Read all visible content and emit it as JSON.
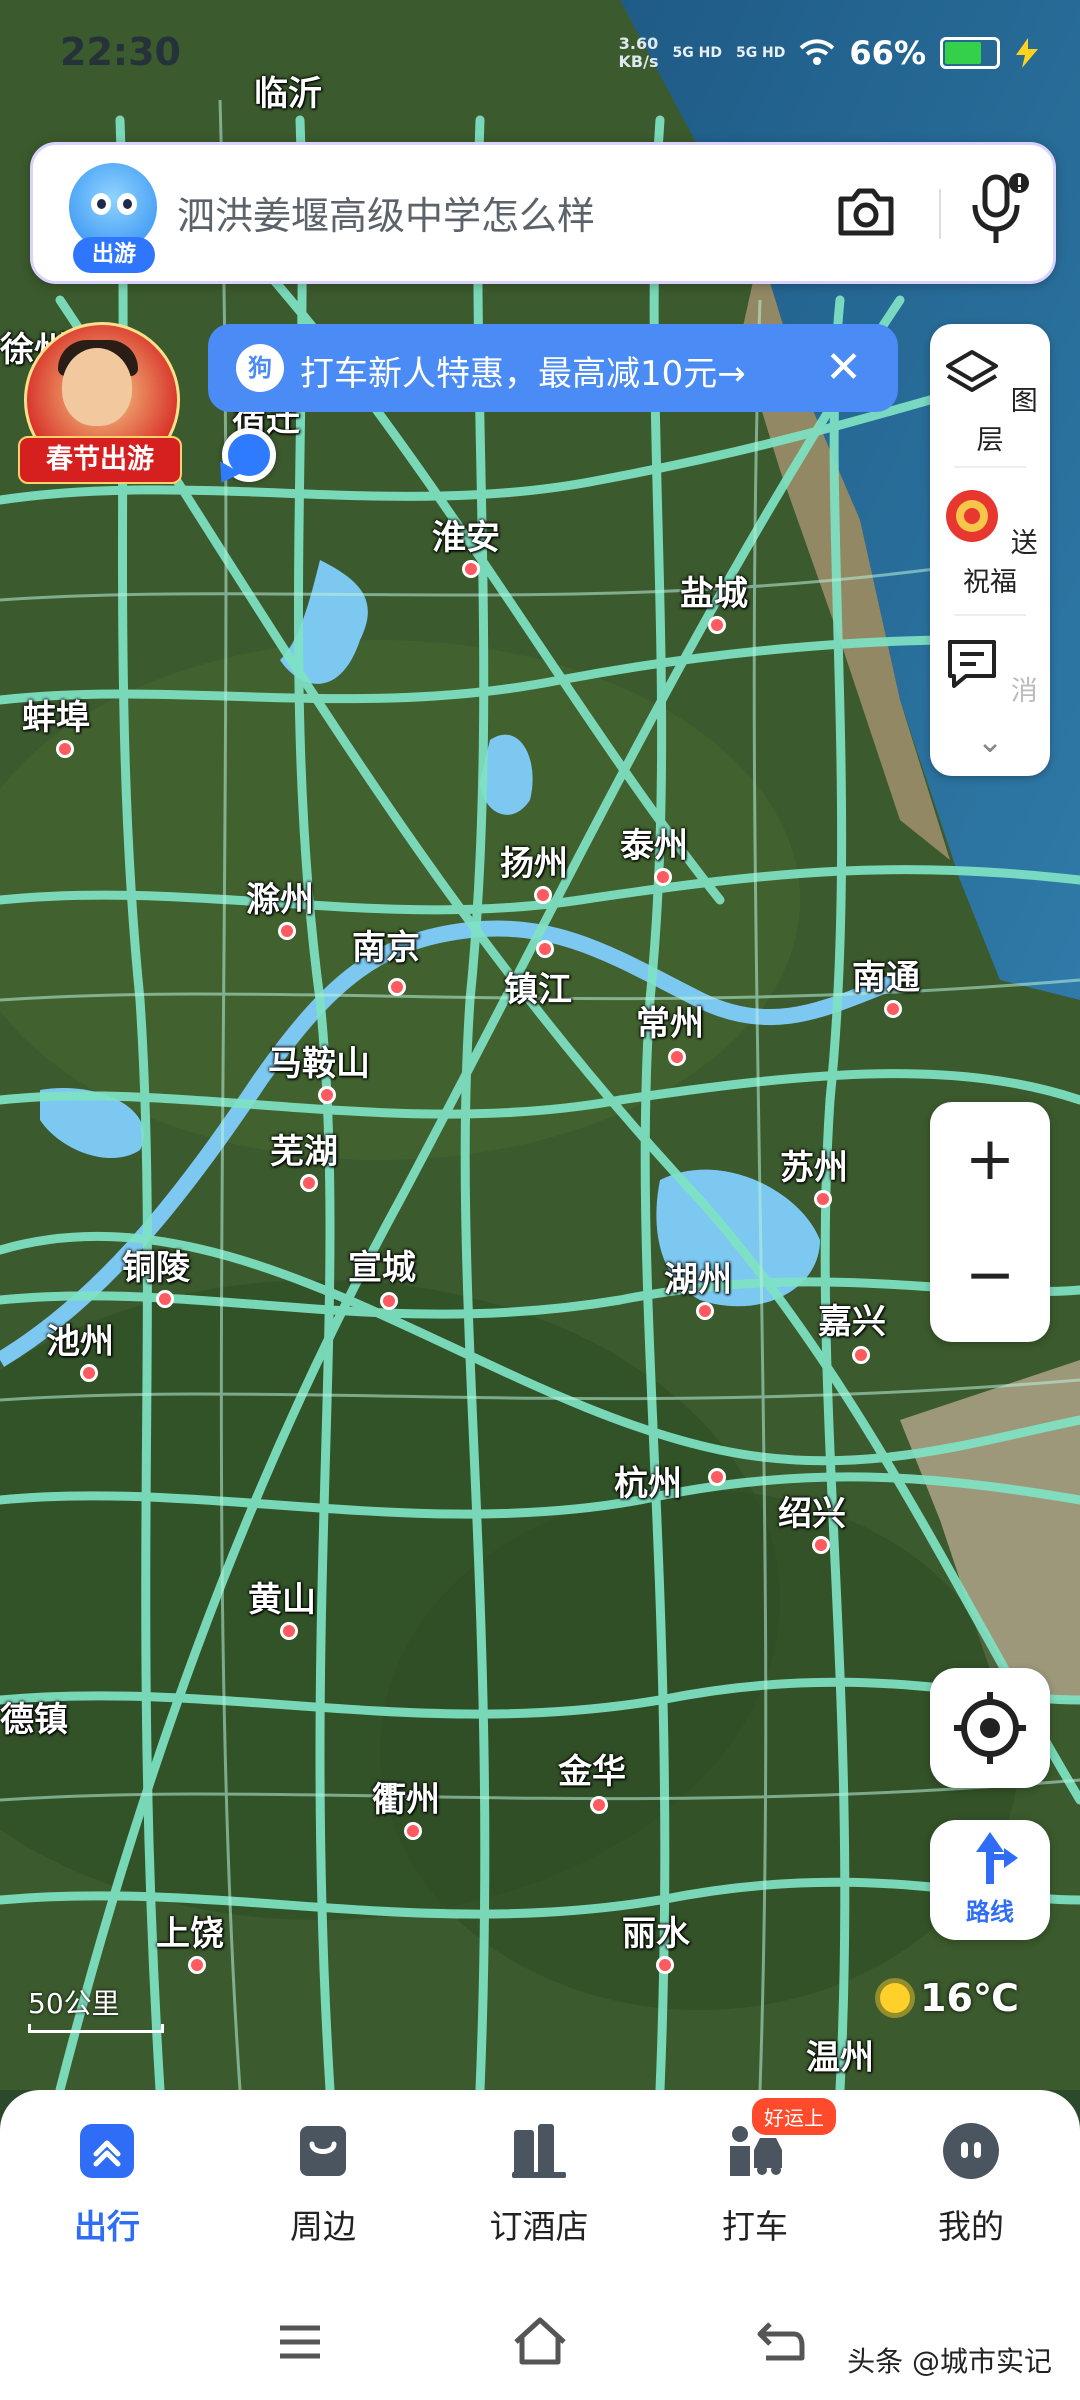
{
  "status_bar": {
    "time": "22:30",
    "net_speed_value": "3.60",
    "net_speed_unit": "KB/s",
    "sim1": "5G HD",
    "sim2": "5G HD",
    "battery": "66%"
  },
  "search": {
    "avatar_chip": "出游",
    "query": "泗洪姜堰高级中学怎么样",
    "icons": [
      "camera-icon",
      "microphone-icon"
    ]
  },
  "festival_badge": {
    "label": "春节出游"
  },
  "promo_banner": {
    "text": "打车新人特惠，最高减10元→",
    "close": "✕",
    "logo": "狗"
  },
  "right_panel": {
    "layers_label": "图层",
    "blessing_label": "送祝福",
    "message_label": "消息",
    "expand": "⌄"
  },
  "zoom": {
    "in": "+",
    "out": "−"
  },
  "route_button": {
    "label": "路线"
  },
  "scale_bar": {
    "label": "50公里"
  },
  "weather": {
    "temperature": "16℃",
    "icon": "sun-icon"
  },
  "cities": [
    {
      "name": "临沂"
    },
    {
      "name": "宿迁"
    },
    {
      "name": "淮安"
    },
    {
      "name": "盐城"
    },
    {
      "name": "蚌埠"
    },
    {
      "name": "扬州"
    },
    {
      "name": "泰州"
    },
    {
      "name": "滁州"
    },
    {
      "name": "南京"
    },
    {
      "name": "镇江"
    },
    {
      "name": "南通"
    },
    {
      "name": "常州"
    },
    {
      "name": "马鞍山"
    },
    {
      "name": "芜湖"
    },
    {
      "name": "苏州"
    },
    {
      "name": "铜陵"
    },
    {
      "name": "宣城"
    },
    {
      "name": "湖州"
    },
    {
      "name": "嘉兴"
    },
    {
      "name": "池州"
    },
    {
      "name": "杭州"
    },
    {
      "name": "绍兴"
    },
    {
      "name": "黄山"
    },
    {
      "name": "德镇"
    },
    {
      "name": "金华"
    },
    {
      "name": "衢州"
    },
    {
      "name": "上饶"
    },
    {
      "name": "丽水"
    },
    {
      "name": "温州"
    },
    {
      "name": "徐州"
    }
  ],
  "tab_bar": {
    "tabs": [
      {
        "label": "出行",
        "active": true
      },
      {
        "label": "周边",
        "active": false
      },
      {
        "label": "订酒店",
        "active": false
      },
      {
        "label": "打车",
        "active": false
      },
      {
        "label": "我的",
        "active": false
      }
    ],
    "taxi_badge": "好运上"
  },
  "nav_bar": {
    "icons": [
      "menu-icon",
      "home-icon",
      "back-icon"
    ]
  },
  "watermark": "头条 @城市实记",
  "colors": {
    "accent": "#2f6df6",
    "road": "#7fe3c4",
    "water": "#7cc8f0",
    "land": "#3a5a2e"
  }
}
